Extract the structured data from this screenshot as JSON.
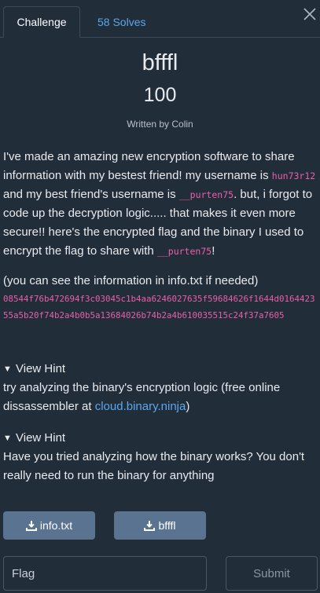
{
  "tabs": {
    "challenge": "Challenge",
    "solves": "58 Solves"
  },
  "challenge": {
    "name": "bfffl",
    "value": "100",
    "author": "Written by Colin",
    "description": {
      "p1_a": "I've made an amazing new encryption software to share information with my bestest friend! my username is ",
      "user1": "hun73r12",
      "p1_b": " and my best friend's username is ",
      "user2": "__purten75",
      "p1_c": ". but, i forgot to code up the decryption logic..... that makes it even more secure!! here's the encrypted flag and the binary I used to encrypt the flag to share with ",
      "user3": "__purten75",
      "p1_d": "!",
      "info_line": "(you can see the information in info.txt if needed)",
      "hash": "08544f76b472694f3c03045c1b4aa6246027635f59684626f1644d016442355a5b20f74b2a4b0b5a13684026b74b2a4b610035515c24f37a7605"
    }
  },
  "hints": [
    {
      "toggle": "View Hint",
      "text_a": "try analyzing the binary's encryption logic (free online dissassembler at ",
      "link": "cloud.binary.ninja",
      "text_b": ")"
    },
    {
      "toggle": "View Hint",
      "text": "Have you tried analyzing how the binary works? You don't really need to run the binary for anything"
    }
  ],
  "files": [
    "info.txt",
    "bfffl"
  ],
  "submission": {
    "placeholder": "Flag",
    "submit_label": "Submit"
  },
  "icons": {
    "close": "close-icon",
    "download": "download-icon",
    "hint_toggle": "triangle-down-icon"
  },
  "colors": {
    "background": "#222d3a",
    "accent": "#5aa7ec",
    "code": "#ea5fa9",
    "file_button": "#5a7391"
  }
}
